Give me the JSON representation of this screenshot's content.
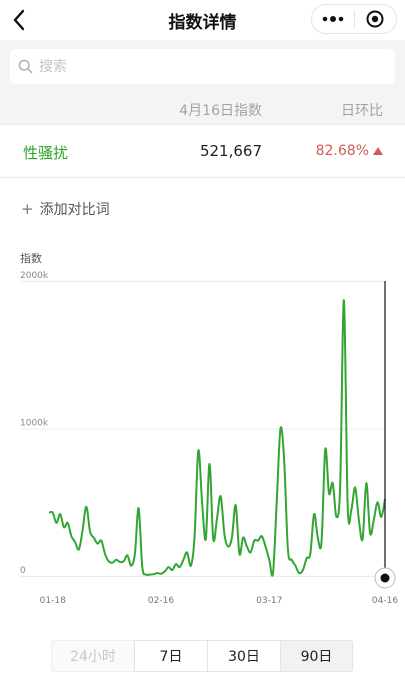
{
  "header": {
    "title": "指数详情",
    "menu_icon": "more-dots-icon",
    "close_icon": "target-circle-icon"
  },
  "search": {
    "placeholder": "搜索"
  },
  "table": {
    "date_header": "4月16日指数",
    "ratio_header": "日环比",
    "rows": [
      {
        "keyword": "性骚扰",
        "value": "521,667",
        "ratio": "82.68%",
        "trend": "up"
      }
    ]
  },
  "add_compare": {
    "label": "添加对比词"
  },
  "chart_data": {
    "type": "line",
    "ylabel": "指数",
    "ylim": [
      0,
      2000000
    ],
    "y_ticks": [
      "2000k",
      "1000k",
      "0"
    ],
    "x_ticks": [
      "01-18",
      "02-16",
      "03-17",
      "04-16"
    ],
    "x_range": [
      "01-17",
      "04-16"
    ],
    "color": "#33a533",
    "series": [
      {
        "values": [
          430000,
          430000,
          360000,
          420000,
          330000,
          360000,
          270000,
          230000,
          180000,
          310000,
          470000,
          300000,
          260000,
          220000,
          240000,
          150000,
          100000,
          90000,
          110000,
          95000,
          100000,
          140000,
          70000,
          150000,
          460000,
          60000,
          10000,
          10000,
          12000,
          20000,
          15000,
          30000,
          60000,
          40000,
          80000,
          60000,
          110000,
          160000,
          70000,
          270000,
          850000,
          500000,
          250000,
          760000,
          250000,
          390000,
          540000,
          280000,
          200000,
          260000,
          480000,
          150000,
          260000,
          200000,
          160000,
          240000,
          240000,
          270000,
          200000,
          110000,
          20000,
          500000,
          1000000,
          780000,
          180000,
          110000,
          70000,
          20000,
          40000,
          120000,
          150000,
          420000,
          260000,
          230000,
          860000,
          560000,
          630000,
          400000,
          620000,
          1870000,
          470000,
          450000,
          600000,
          380000,
          250000,
          630000,
          290000,
          380000,
          500000,
          400000,
          521667
        ]
      }
    ]
  },
  "periods": {
    "p24h": "24小时",
    "p7": "7日",
    "p30": "30日",
    "p90": "90日",
    "selected": "90日"
  }
}
